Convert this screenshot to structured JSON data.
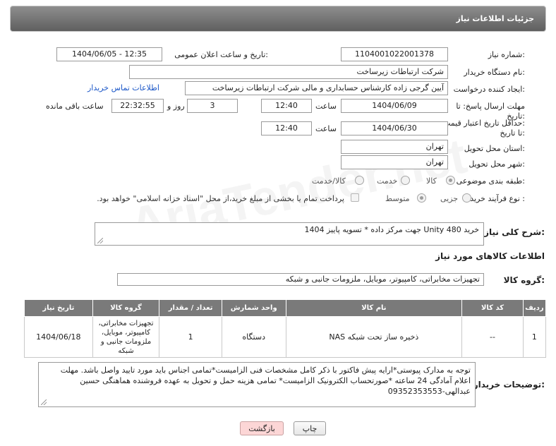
{
  "header": {
    "title": "جزئیات اطلاعات نیاز"
  },
  "fields": {
    "need_number_label": "شماره نیاز:",
    "need_number": "1104001022001378",
    "announce_label": "تاریخ و ساعت اعلان عمومی:",
    "announce_value": "1404/06/05 - 12:35",
    "buyer_org_label": "نام دستگاه خریدار:",
    "buyer_org": "شرکت ارتباطات زیرساخت",
    "creator_label": "ایجاد کننده درخواست:",
    "creator": "آیین گرجی زاده کارشناس حسابداری و مالی شرکت ارتباطات زیرساخت",
    "contact_link": "اطلاعات تماس خریدار",
    "reply_deadline_label_1": "مهلت ارسال پاسخ: تا",
    "reply_deadline_label_2": "تاریخ:",
    "reply_date": "1404/06/09",
    "time_label": "ساعت",
    "reply_time": "12:40",
    "days_value": "3",
    "days_label": "روز و",
    "remaining_time": "22:32:55",
    "remaining_label": "ساعت باقی مانده",
    "price_validity_label_1": "حداقل تاریخ اعتبار قیمت:",
    "price_validity_label_2": "تا تاریخ:",
    "price_date": "1404/06/30",
    "price_time": "12:40",
    "province_label": "استان محل تحویل:",
    "province": "تهران",
    "city_label": "شهر محل تحویل:",
    "city": "تهران",
    "category_label": "طبقه بندی موضوعی:",
    "category_options": [
      "کالا",
      "خدمت",
      "کالا/خدمت"
    ],
    "process_label": "نوع فرآیند خرید :",
    "process_options": [
      "جزیی",
      "متوسط"
    ],
    "treasury_text": "پرداخت تمام یا بخشی از مبلغ خرید،از محل \"اسناد خزانه اسلامی\" خواهد بود."
  },
  "description": {
    "label": "شرح کلی نیاز:",
    "text": "خرید Unity 480 جهت مرکز داده  * تسویه پاییز 1404"
  },
  "goods_info_title": "اطلاعات کالاهای مورد نیاز",
  "goods_group": {
    "label": "گروه کالا:",
    "value": "تجهیزات مخابراتی، کامپیوتر، موبایل، ملزومات جانبی و شبکه"
  },
  "table": {
    "headers": [
      "ردیف",
      "کد کالا",
      "نام کالا",
      "واحد شمارش",
      "تعداد / مقدار",
      "گروه کالا",
      "تاریخ نیاز"
    ],
    "rows": [
      [
        "1",
        "--",
        "ذخیره ساز تحت شبکه NAS",
        "دستگاه",
        "1",
        "تجهیزات مخابراتی، کامپیوتر، موبایل، ملزومات جانبی و شبکه",
        "1404/06/18"
      ]
    ]
  },
  "buyer_notes": {
    "label": "توضیحات خریدار:",
    "text": "توجه به مدارک پیوستی*ارایه پیش فاکتور با ذکر کامل مشخصات فنی الزامیست*تمامی اجناس باید مورد تایید واصل باشد. مهلت اعلام آمادگی 24 ساعته *صورتحساب الکترونیک الزامیست* تمامی هزینه حمل و تحویل به عهده فروشنده هماهنگی حسین عبدالهی-09352353553"
  },
  "buttons": {
    "print": "چاپ",
    "back": "بازگشت"
  },
  "watermark": "AriaTender.net"
}
